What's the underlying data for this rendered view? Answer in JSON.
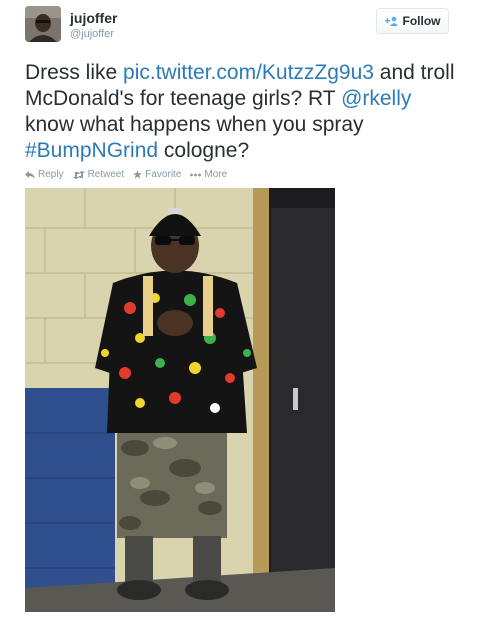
{
  "user": {
    "name": "jujoffer",
    "handle": "@jujoffer"
  },
  "follow_label": "Follow",
  "tweet": {
    "text_1": "Dress like ",
    "link": "pic.twitter.com/KutzzZg9u3",
    "text_2": " and troll McDonald's for teenage girls? RT ",
    "mention": "@rkelly",
    "text_3": " know what happens when you spray ",
    "hashtag": "#BumpNGrind",
    "text_4": " cologne?"
  },
  "actions": {
    "reply": "Reply",
    "retweet": "Retweet",
    "favorite": "Favorite",
    "more": "More"
  },
  "colors": {
    "link": "#2b7bb9",
    "meta": "#8899a6",
    "text": "#292f33"
  },
  "icons": [
    "follow-icon",
    "reply-icon",
    "retweet-icon",
    "favorite-icon",
    "more-icon"
  ]
}
